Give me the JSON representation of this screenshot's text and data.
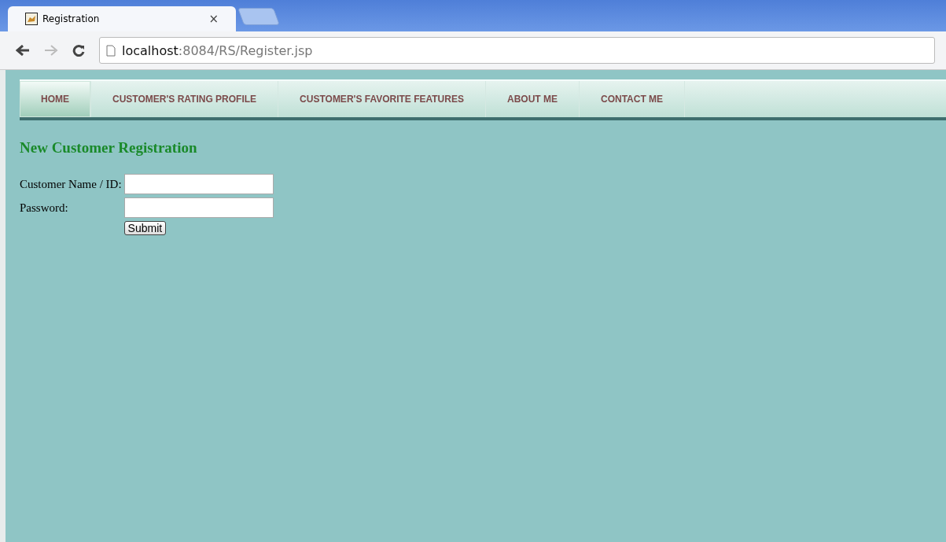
{
  "browser": {
    "tab_title": "Registration",
    "close": "×",
    "address_host": "localhost",
    "address_path": ":8084/RS/Register.jsp"
  },
  "nav": [
    {
      "label": "HOME",
      "selected": true
    },
    {
      "label": "CUSTOMER'S RATING PROFILE",
      "selected": false
    },
    {
      "label": "CUSTOMER'S FAVORITE FEATURES",
      "selected": false
    },
    {
      "label": "ABOUT ME",
      "selected": false
    },
    {
      "label": "CONTACT ME",
      "selected": false
    }
  ],
  "heading": "New Customer Registration",
  "form": {
    "fields": [
      {
        "label": "Customer Name / ID:"
      },
      {
        "label": "Password:"
      }
    ],
    "submit": "Submit"
  }
}
